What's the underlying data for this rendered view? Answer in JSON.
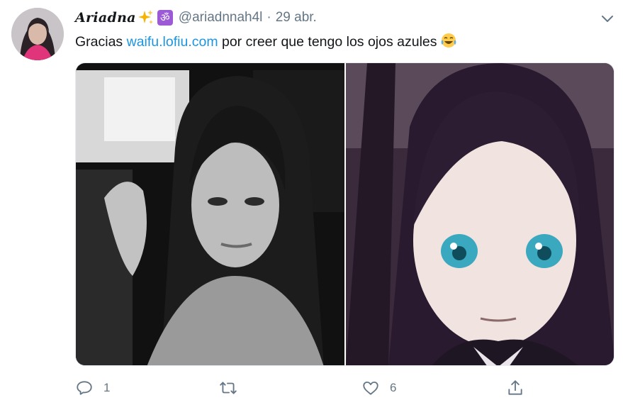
{
  "tweet": {
    "display_name": "Ariadna",
    "badge_glyph": "ॐ",
    "handle": "@ariadnnah4l",
    "separator": "·",
    "date": "29 abr.",
    "text_before": "Gracias ",
    "link_text": "waifu.lofiu.com",
    "text_after": " por creer que tengo los ojos azules",
    "name_emoji_icon": "sparkles-icon",
    "text_emoji_icon": "tears-of-joy-icon"
  },
  "media": {
    "left_photo": "grayscale-selfie-photo",
    "right_photo": "anime-portrait-image"
  },
  "actions": {
    "reply_count": "1",
    "retweet_count": "",
    "like_count": "6"
  },
  "colors": {
    "link": "#1b95e0",
    "secondary_text": "#657786",
    "badge_bg": "#9c5ad6"
  }
}
